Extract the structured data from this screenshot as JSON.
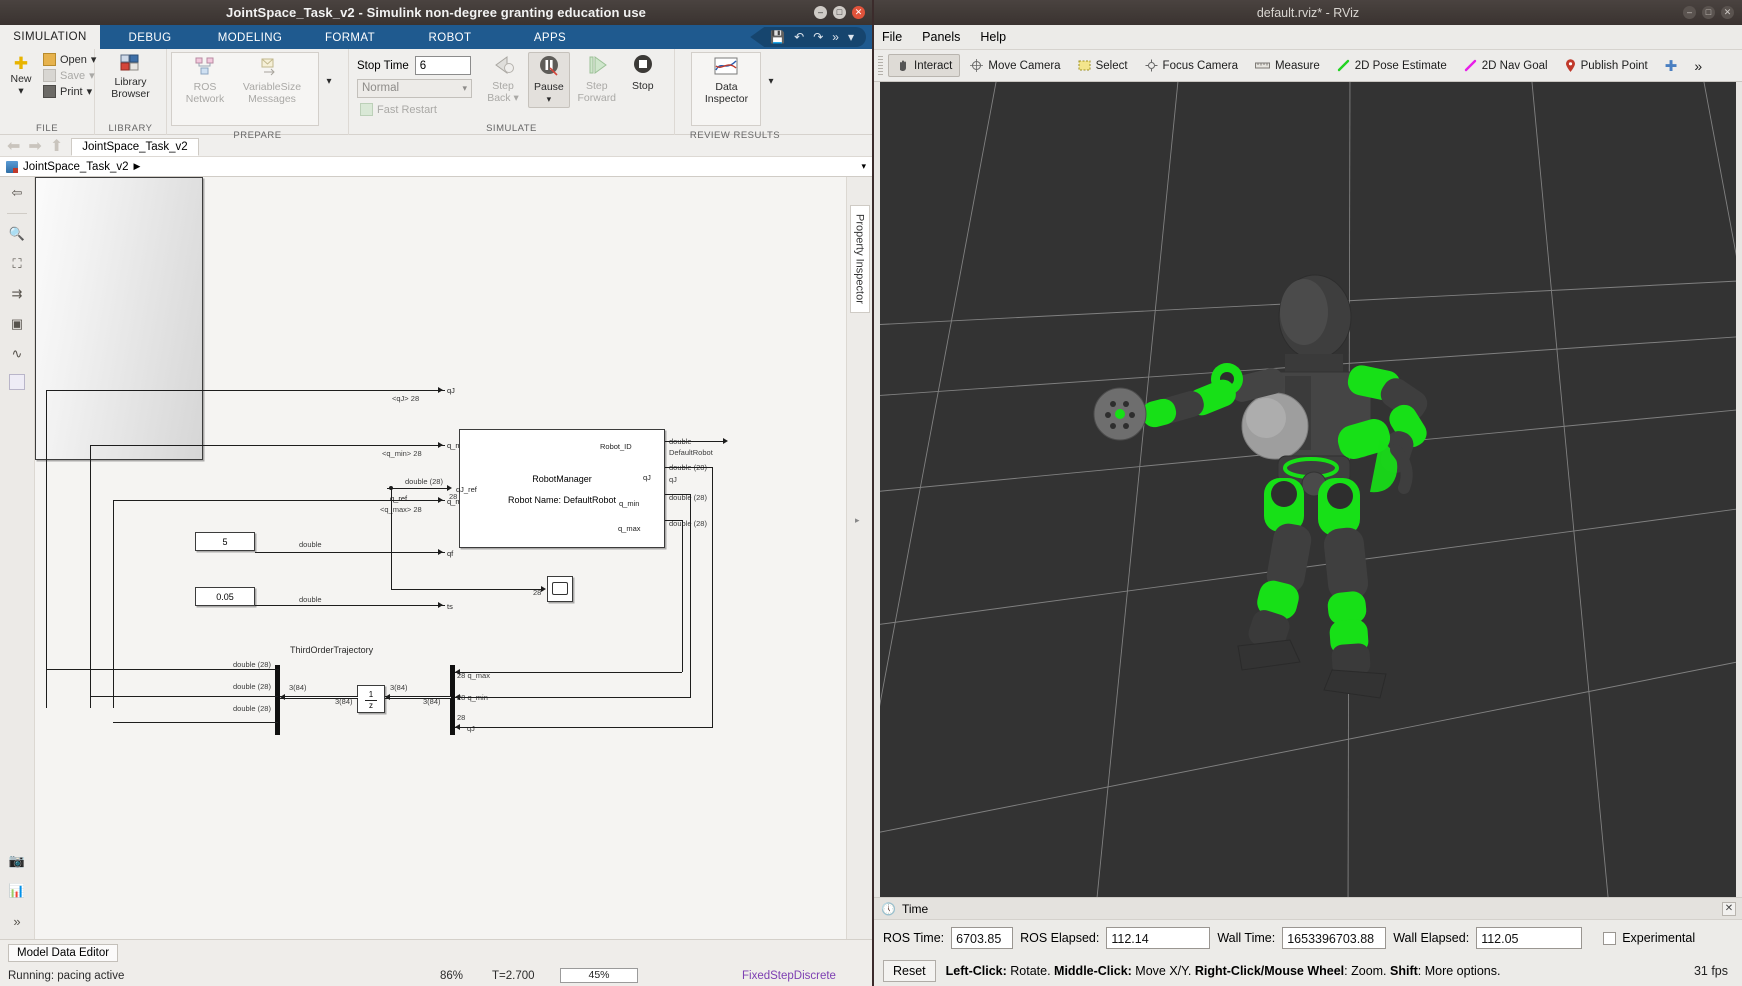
{
  "simulink": {
    "window_title": "JointSpace_Task_v2 - Simulink non-degree granting education use",
    "window_buttons": {
      "minimize": "–",
      "maximize": "□",
      "close": "✕"
    },
    "ribbon_tabs": [
      {
        "label": "SIMULATION",
        "active": true
      },
      {
        "label": "DEBUG",
        "active": false
      },
      {
        "label": "MODELING",
        "active": false
      },
      {
        "label": "FORMAT",
        "active": false
      },
      {
        "label": "ROBOT",
        "active": false
      },
      {
        "label": "APPS",
        "active": false
      }
    ],
    "quick_access": [
      "save-icon",
      "undo-icon",
      "redo-icon",
      "more-icon",
      "chevron-down-icon"
    ],
    "groups": [
      {
        "name": "FILE",
        "label": "FILE"
      },
      {
        "name": "LIBRARY",
        "label": "LIBRARY"
      },
      {
        "name": "PREPARE",
        "label": "PREPARE"
      },
      {
        "name": "SIMULATE",
        "label": "SIMULATE"
      },
      {
        "name": "REVIEW RESULTS",
        "label": "REVIEW RESULTS"
      }
    ],
    "file_group": {
      "new_label": "New",
      "open_label": "Open",
      "save_label": "Save",
      "print_label": "Print"
    },
    "library_group": {
      "line1": "Library",
      "line2": "Browser"
    },
    "prepare_group": {
      "ros_network": "ROS\nNetwork",
      "ros_network_l1": "ROS",
      "ros_network_l2": "Network",
      "variable_size_l1": "VariableSize",
      "variable_size_l2": "Messages"
    },
    "simulate_group": {
      "stop_time_label": "Stop Time",
      "stop_time_value": "6",
      "mode_value": "Normal",
      "fast_restart": "Fast Restart",
      "step_back_l1": "Step",
      "step_back_l2": "Back",
      "pause_label": "Pause",
      "step_forward_l1": "Step",
      "step_forward_l2": "Forward",
      "stop_label": "Stop"
    },
    "review_group": {
      "data_inspector_l1": "Data",
      "data_inspector_l2": "Inspector"
    },
    "explorer": {
      "model_tab": "JointSpace_Task_v2"
    },
    "breadcrumb": {
      "text": "JointSpace_Task_v2",
      "arrow": "▶"
    },
    "palette_icons": [
      "back-to-parent-icon",
      "zoom-in-icon",
      "fit-to-view-icon",
      "signal-routing-icon",
      "annotation-icon",
      "scope-preview-icon",
      "block-icon"
    ],
    "palette_bottom_icons": [
      "camera-icon",
      "library-icon",
      "expand-icon"
    ],
    "property_inspector_tab": "Property Inspector",
    "model_data_editor": "Model Data Editor",
    "status": {
      "run_state": "Running: pacing active",
      "zoom": "86%",
      "sim_time": "T=2.700",
      "progress_pct": "45%",
      "progress_value": 45,
      "solver": "FixedStepDiscrete"
    },
    "diagram": {
      "blocks": [
        {
          "name": "ThirdOrderTrajectory",
          "label": "ThirdOrderTrajectory"
        },
        {
          "name": "RobotManager",
          "title": "RobotManager",
          "subtitle": "Robot Name: DefaultRobot"
        },
        {
          "name": "constant-5",
          "value": "5"
        },
        {
          "name": "constant-ts",
          "value": "0.05"
        },
        {
          "name": "unit-delay",
          "value": "1\nz",
          "num": "1",
          "den": "z"
        },
        {
          "name": "scope",
          "value": ""
        }
      ],
      "trajectory_inputs": [
        {
          "port": "qJ",
          "signal": "<qJ>",
          "width": "28"
        },
        {
          "port": "q_min",
          "signal": "<q_min>",
          "width": "28"
        },
        {
          "port": "q_max",
          "signal": "<q_max>",
          "width": "28"
        },
        {
          "port": "qf",
          "signal": "double",
          "width": ""
        },
        {
          "port": "ts",
          "signal": "double",
          "width": ""
        }
      ],
      "trajectory_output": {
        "port": "q_ref",
        "signal": "double (28)",
        "width": "28"
      },
      "manager_input": {
        "port": "qJ_ref",
        "width": "28"
      },
      "manager_outputs": [
        {
          "port": "Robot_ID",
          "signal": "double",
          "label": "DefaultRobot"
        },
        {
          "port": "qJ",
          "signal": "double (28)",
          "label": "qJ"
        },
        {
          "port": "q_min",
          "signal": "double (28)",
          "label": ""
        },
        {
          "port": "q_max",
          "signal": "double (28)",
          "label": ""
        }
      ],
      "bus_labels": [
        "double (28)",
        "double (28)",
        "double (28)"
      ],
      "demux_labels": [
        "3(84)",
        "3(84)",
        "3(84)",
        "3(84)"
      ],
      "mux_port_labels": [
        {
          "width": "28",
          "name": "q_max"
        },
        {
          "width": "28",
          "name": "q_min"
        },
        {
          "width": "28",
          "name": "qJ"
        }
      ],
      "scope_input_width": "28"
    }
  },
  "rviz": {
    "window_title": "default.rviz* - RViz",
    "window_buttons": {
      "minimize": "–",
      "maximize": "□",
      "close": "✕"
    },
    "menus": [
      "File",
      "Panels",
      "Help"
    ],
    "toolbar": [
      {
        "label": "Interact",
        "icon": "hand-cursor-icon",
        "active": true
      },
      {
        "label": "Move Camera",
        "icon": "move-camera-icon",
        "active": false
      },
      {
        "label": "Select",
        "icon": "select-rect-icon",
        "active": false
      },
      {
        "label": "Focus Camera",
        "icon": "focus-camera-icon",
        "active": false
      },
      {
        "label": "Measure",
        "icon": "ruler-icon",
        "active": false
      },
      {
        "label": "2D Pose Estimate",
        "icon": "green-arrow-icon",
        "active": false
      },
      {
        "label": "2D Nav Goal",
        "icon": "magenta-arrow-icon",
        "active": false
      },
      {
        "label": "Publish Point",
        "icon": "map-pin-icon",
        "active": false
      }
    ],
    "toolbar_extra": {
      "plus": "✚",
      "overflow": "»"
    },
    "time_panel": {
      "header": "Time",
      "header_icon": "clock-icon",
      "close_icon": "✕",
      "ros_time_label": "ROS Time:",
      "ros_time_value": "6703.85",
      "ros_elapsed_label": "ROS Elapsed:",
      "ros_elapsed_value": "112.14",
      "wall_time_label": "Wall Time:",
      "wall_time_value": "1653396703.88",
      "wall_elapsed_label": "Wall Elapsed:",
      "wall_elapsed_value": "112.05",
      "experimental_label": "Experimental",
      "reset_label": "Reset",
      "hint_1_bold": "Left-Click:",
      "hint_1": " Rotate. ",
      "hint_2_bold": "Middle-Click:",
      "hint_2": " Move X/Y. ",
      "hint_3_bold": "Right-Click/Mouse Wheel",
      "hint_3": ": Zoom. ",
      "hint_4_bold": "Shift",
      "hint_4": ": More options.",
      "fps": "31 fps"
    },
    "viewport": {
      "background_color": "#333333",
      "grid_color": "#9a9a9a",
      "robot_accent_color": "#17e017",
      "robot_body_color": "#4b4b4b"
    }
  }
}
